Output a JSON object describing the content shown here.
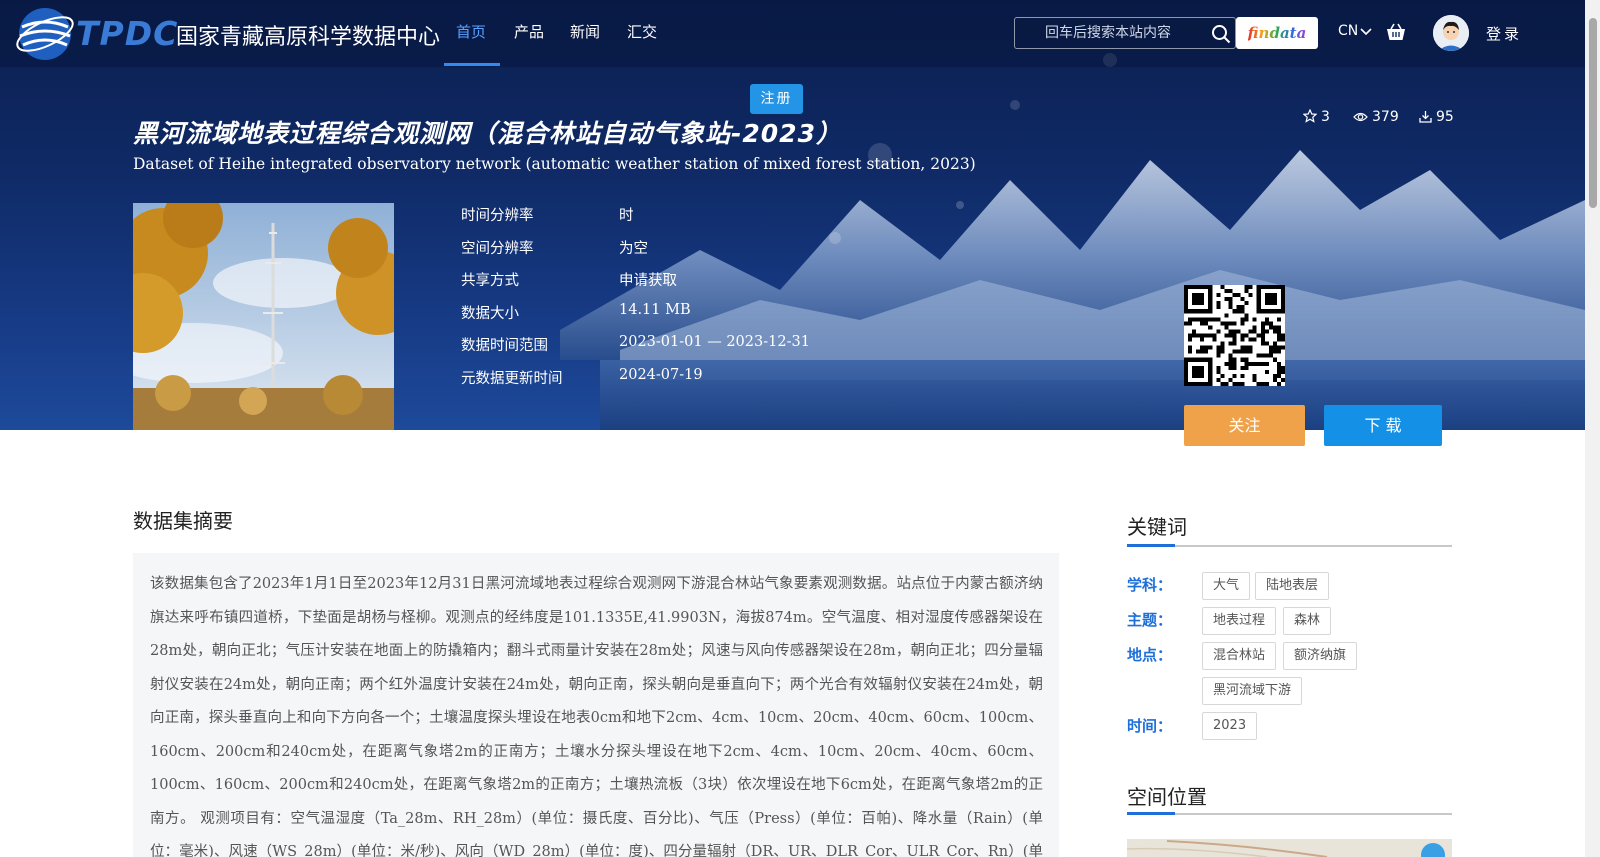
{
  "nav": {
    "logo_text": "TPDC",
    "site_name": "国家青藏高原科学数据中心",
    "menu": [
      {
        "label": "首页",
        "active": true
      },
      {
        "label": "产品",
        "active": false
      },
      {
        "label": "新闻",
        "active": false
      },
      {
        "label": "汇交",
        "active": false
      }
    ],
    "search_placeholder": "回车后搜索本站内容",
    "findata_label": "findata",
    "lang_label": "CN",
    "login_label": "登录",
    "register_label": "注册"
  },
  "dataset": {
    "title_cn": "黑河流域地表过程综合观测网（混合林站自动气象站-2023）",
    "title_en": "Dataset of Heihe integrated observatory network (automatic weather station of mixed forest station, 2023)",
    "stats": {
      "stars": "3",
      "views": "379",
      "downloads": "95"
    },
    "meta": [
      {
        "label": "时间分辨率",
        "value": "时"
      },
      {
        "label": "空间分辨率",
        "value": "为空"
      },
      {
        "label": "共享方式",
        "value": "申请获取"
      },
      {
        "label": "数据大小",
        "value": "14.11 MB"
      },
      {
        "label": "数据时间范围",
        "value": "2023-01-01 — 2023-12-31"
      },
      {
        "label": "元数据更新时间",
        "value": "2024-07-19"
      }
    ],
    "follow_label": "关注",
    "download_label": "下 载"
  },
  "abstract": {
    "title": "数据集摘要",
    "text": "该数据集包含了2023年1月1日至2023年12月31日黑河流域地表过程综合观测网下游混合林站气象要素观测数据。站点位于内蒙古额济纳旗达来呼布镇四道桥，下垫面是胡杨与柽柳。观测点的经纬度是101.1335E,41.9903N，海拔874m。空气温度、相对湿度传感器架设在28m处，朝向正北；气压计安装在地面上的防撬箱内；翻斗式雨量计安装在28m处；风速与风向传感器架设在28m，朝向正北；四分量辐射仪安装在24m处，朝向正南；两个红外温度计安装在24m处，朝向正南，探头朝向是垂直向下；两个光合有效辐射仪安装在24m处，朝向正南，探头垂直向上和向下方向各一个；土壤温度探头埋设在地表0cm和地下2cm、4cm、10cm、20cm、40cm、60cm、100cm、160cm、200cm和240cm处，在距离气象塔2m的正南方；土壤水分探头埋设在地下2cm、4cm、10cm、20cm、40cm、60cm、100cm、160cm、200cm和240cm处，在距离气象塔2m的正南方；土壤热流板（3块）依次埋设在地下6cm处，在距离气象塔2m的正南方。 观测项目有：空气温湿度（Ta_28m、RH_28m）(单位：摄氏度、百分比)、气压（Press）(单位：百帕)、降水量（Rain）(单位：毫米)、风速（WS_28m）(单位：米/秒)、风向（WD_28m）(单位：度)、四分量辐射（DR、UR、DLR_Cor、ULR_Cor、Rn）(单位：瓦/平方米)、地"
  },
  "keywords": {
    "title": "关键词",
    "groups": [
      {
        "label": "学科：",
        "tags": [
          "大气",
          "陆地表层"
        ]
      },
      {
        "label": "主题：",
        "tags": [
          "地表过程",
          "森林"
        ]
      },
      {
        "label": "地点：",
        "tags": [
          "混合林站",
          "额济纳旗",
          "黑河流域下游"
        ]
      },
      {
        "label": "时间：",
        "tags": [
          "2023"
        ]
      }
    ]
  },
  "location": {
    "title": "空间位置"
  }
}
